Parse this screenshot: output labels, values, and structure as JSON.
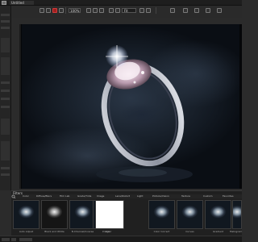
{
  "window": {
    "title": "Untitled"
  },
  "toolbar": {
    "zoom_value": "100%",
    "fit_value": "Fit",
    "accent_color": "#d23a3a"
  },
  "canvas": {
    "image_subject": "diamond ring on dark smoky background"
  },
  "filters": {
    "header": "Filters",
    "categories": [
      "Color",
      "Diffuse/Blurs",
      "Film Lab",
      "Grade/Tints",
      "Image",
      "Lens/Distort",
      "Light",
      "Pinhole/Vision",
      "Texture",
      "Custom",
      "Favorites"
    ],
    "thumbnails": [
      {
        "label": "Auto Adjust",
        "style": "color"
      },
      {
        "label": "Black and White",
        "style": "bw"
      },
      {
        "label": "B-Channel/Inverse",
        "style": "color"
      },
      {
        "label": "Image",
        "style": "color"
      },
      {
        "label": "Color",
        "style": "white"
      },
      {
        "label": "Color Correct",
        "style": "color"
      },
      {
        "label": "Curves",
        "style": "color"
      },
      {
        "label": "Gradient",
        "style": "color"
      },
      {
        "label": "Histogram",
        "style": "color"
      }
    ]
  }
}
